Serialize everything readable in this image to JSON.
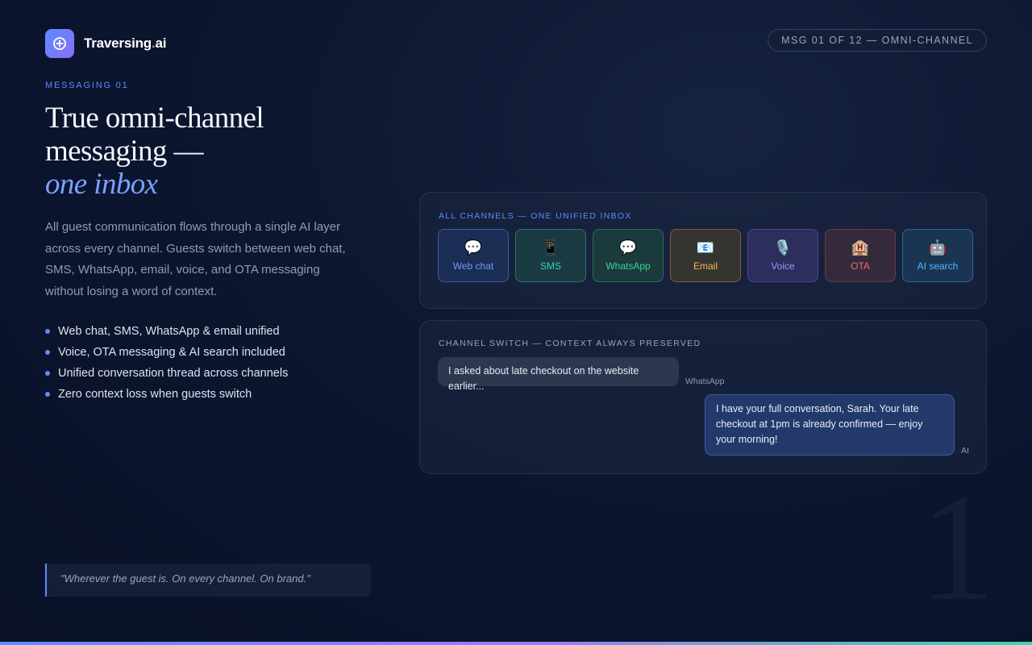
{
  "brand": {
    "name": "Traversing",
    "tld_dot": ".",
    "tld": "ai"
  },
  "header": {
    "progress_pill": "MSG 01 OF 12 — OMNI-CHANNEL"
  },
  "hero": {
    "eyebrow": "MESSAGING 01",
    "headline_line1": "True omni-channel",
    "headline_line2": "messaging —",
    "headline_accent": "one inbox",
    "body": "All guest communication flows through a single AI layer across every channel. Guests switch between web chat, SMS, WhatsApp, email, voice, and OTA messaging without losing a word of context.",
    "bullets": [
      "Web chat, SMS, WhatsApp & email unified",
      "Voice, OTA messaging & AI search included",
      "Unified conversation thread across channels",
      "Zero context loss when guests switch"
    ],
    "quote": "\"Wherever the guest is. On every channel. On brand.\""
  },
  "inbox_card": {
    "label": "ALL CHANNELS — ONE UNIFIED INBOX",
    "channels": [
      {
        "label": "Web chat",
        "icon": "speech-bubble-icon",
        "glyph": "💬",
        "color": "#6b9bff",
        "border": "#3b5aa8",
        "bg": "#1c2d55"
      },
      {
        "label": "SMS",
        "icon": "mobile-phone-icon",
        "glyph": "📱",
        "color": "#3fd4b0",
        "border": "#2b7468",
        "bg": "#1a3a42"
      },
      {
        "label": "WhatsApp",
        "icon": "speech-bubble-icon",
        "glyph": "💬",
        "color": "#3ed78f",
        "border": "#2c6f54",
        "bg": "#1a3a3c"
      },
      {
        "label": "Email",
        "icon": "envelope-icon",
        "glyph": "📧",
        "color": "#f7b955",
        "border": "#7a6333",
        "bg": "#36342f"
      },
      {
        "label": "Voice",
        "icon": "microphone-icon",
        "glyph": "🎙️",
        "color": "#a78bfa",
        "border": "#4f4592",
        "bg": "#2c2f5c"
      },
      {
        "label": "OTA",
        "icon": "hotel-icon",
        "glyph": "🏨",
        "color": "#f06a6a",
        "border": "#6e3846",
        "bg": "#352a3c"
      },
      {
        "label": "AI search",
        "icon": "robot-icon",
        "glyph": "🤖",
        "color": "#4fb8ff",
        "border": "#2e6694",
        "bg": "#1a3552"
      }
    ]
  },
  "switch_card": {
    "label": "CHANNEL SWITCH — CONTEXT ALWAYS PRESERVED",
    "guest_message": "I asked about late checkout on the website earlier...",
    "guest_channel": "WhatsApp",
    "ai_message": "I have your full conversation, Sarah. Your late checkout at 1pm is already confirmed — enjoy your morning!",
    "ai_label": "AI"
  },
  "watermark_numeral": "1"
}
